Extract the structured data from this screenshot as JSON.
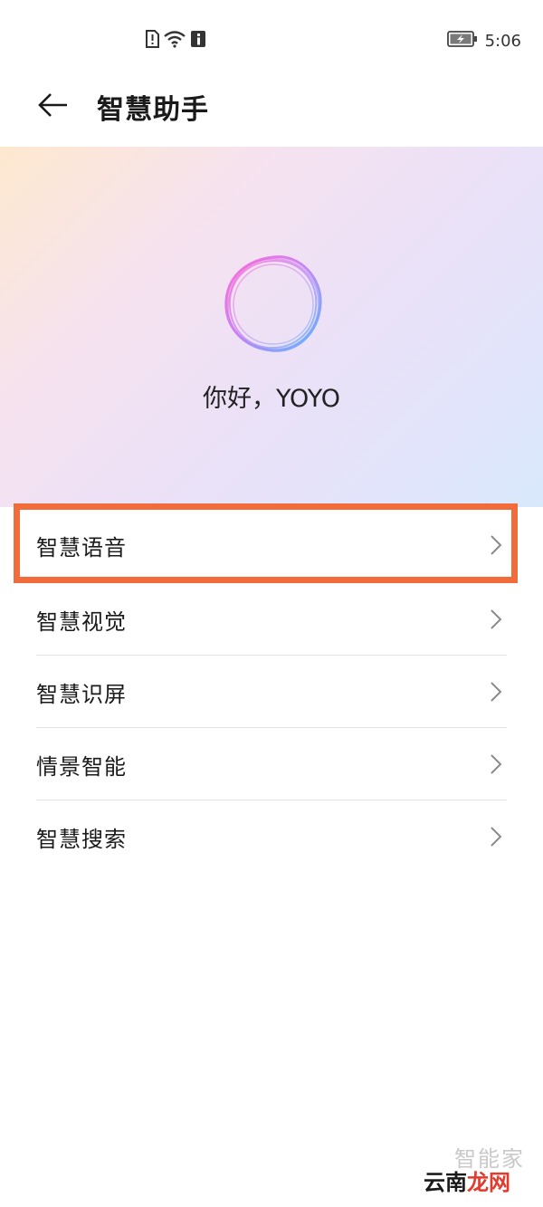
{
  "status_bar": {
    "time": "5:06",
    "icons": [
      "sim-alert-icon",
      "wifi-icon",
      "info-icon",
      "battery-charging-icon"
    ]
  },
  "header": {
    "title": "智慧助手",
    "back_icon": "arrow-left-icon"
  },
  "banner": {
    "greeting": "你好，YOYO",
    "logo_icon": "assistant-ring-icon"
  },
  "menu": {
    "items": [
      {
        "label": "智慧语音",
        "highlighted": true
      },
      {
        "label": "智慧视觉"
      },
      {
        "label": "智慧识屏"
      },
      {
        "label": "情景智能"
      },
      {
        "label": "智慧搜索"
      }
    ]
  },
  "watermark": {
    "top_text": "智能家",
    "bottom_prefix": "云南",
    "bottom_suffix": "龙网"
  },
  "colors": {
    "highlight": "#f26b3a",
    "divider": "#e2e2e2"
  }
}
